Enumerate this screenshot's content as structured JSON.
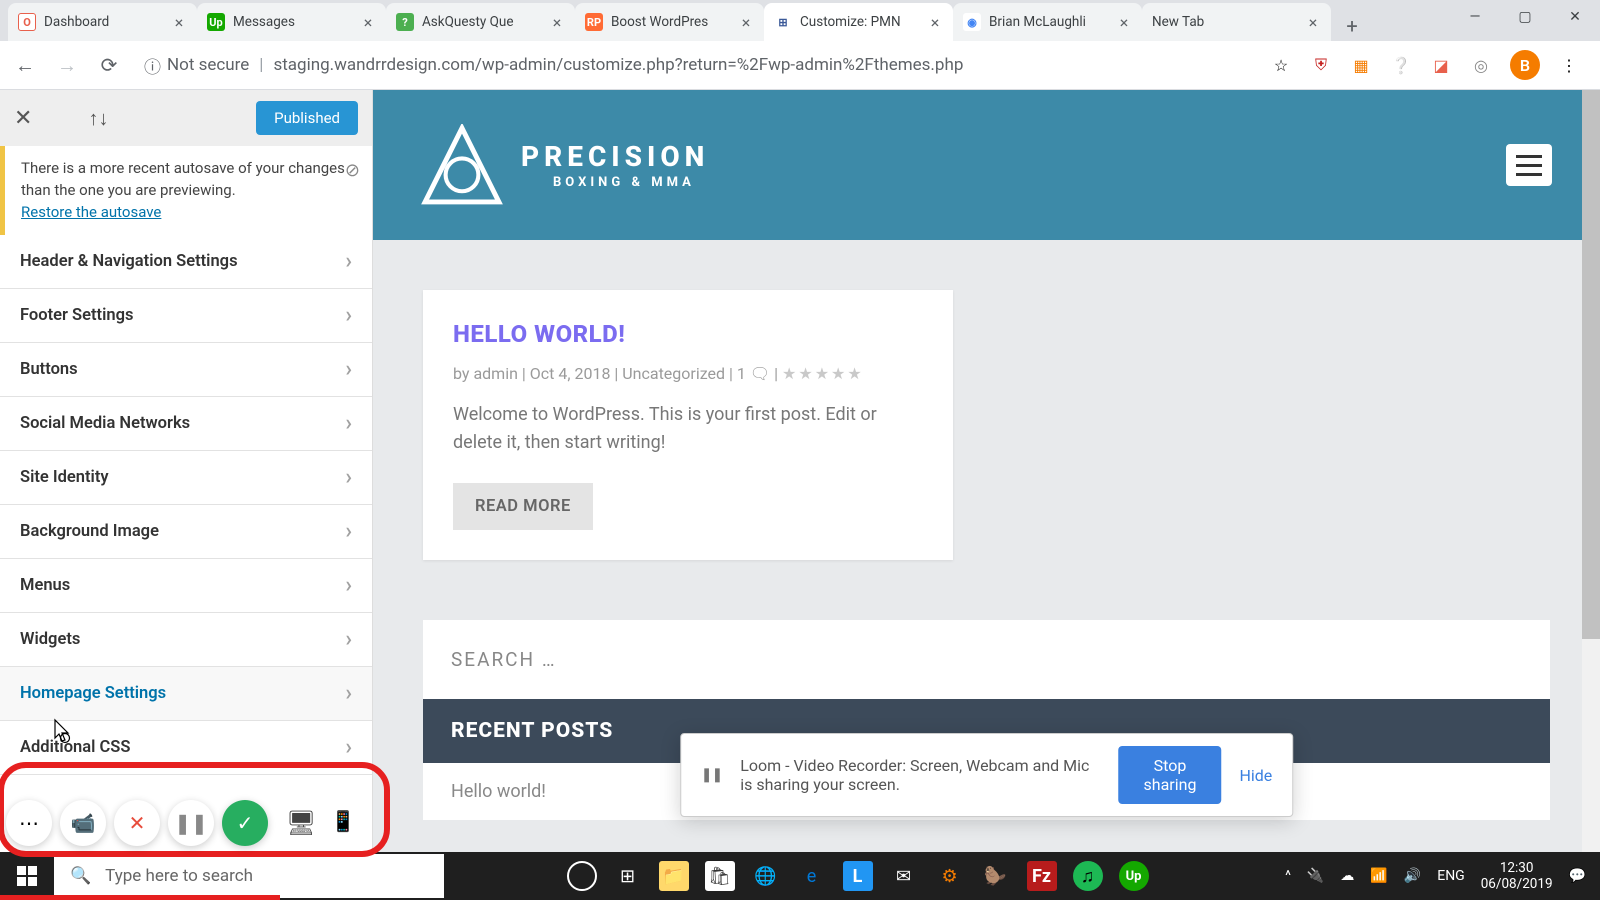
{
  "browser": {
    "tabs": [
      {
        "icon_bg": "#fff",
        "icon_txt": "O",
        "icon_color": "#e8604c",
        "title": "Dashboard"
      },
      {
        "icon_bg": "#14a800",
        "icon_txt": "Up",
        "icon_color": "#fff",
        "title": "Messages"
      },
      {
        "icon_bg": "#4caf50",
        "icon_txt": "?",
        "icon_color": "#fff",
        "title": "AskQuesty Que"
      },
      {
        "icon_bg": "#ff6b35",
        "icon_txt": "RP",
        "icon_color": "#fff",
        "title": "Boost WordPres"
      },
      {
        "icon_bg": "#3b5998",
        "icon_txt": "⊞",
        "icon_color": "#fff",
        "title": "Customize: PMN",
        "active": true
      },
      {
        "icon_bg": "#fff",
        "icon_txt": "◉",
        "icon_color": "#4285f4",
        "title": "Brian McLaughli"
      },
      {
        "icon_bg": "",
        "icon_txt": "",
        "icon_color": "",
        "title": "New Tab"
      }
    ],
    "security_label": "Not secure",
    "url": "staging.wandrrdesign.com/wp-admin/customize.php?return=%2Fwp-admin%2Fthemes.php",
    "avatar_letter": "B"
  },
  "customizer": {
    "published_label": "Published",
    "autosave_msg": "There is a more recent autosave of your changes than the one you are previewing.",
    "autosave_link": "Restore the autosave",
    "panels": [
      "Header & Navigation Settings",
      "Footer Settings",
      "Buttons",
      "Social Media Networks",
      "Site Identity",
      "Background Image",
      "Menus",
      "Widgets",
      "Homepage Settings",
      "Additional CSS"
    ]
  },
  "site": {
    "logo_line1": "PRECISION",
    "logo_line2": "BOXING & MMA",
    "post": {
      "title": "HELLO WORLD!",
      "meta_author_prefix": "by ",
      "meta_author": "admin",
      "meta_date": "Oct 4, 2018",
      "meta_cat": "Uncategorized",
      "meta_comments": "1 🗨",
      "excerpt": "Welcome to WordPress. This is your first post. Edit or delete it, then start writing!",
      "read_more": "READ MORE"
    },
    "search_placeholder": "SEARCH …",
    "recent_posts_title": "RECENT POSTS",
    "recent_post_item": "Hello world!"
  },
  "share_bar": {
    "msg": "Loom - Video Recorder: Screen, Webcam and Mic is sharing your screen.",
    "stop": "Stop sharing",
    "hide": "Hide"
  },
  "taskbar": {
    "search_placeholder": "Type here to search",
    "lang": "ENG",
    "time": "12:30",
    "date": "06/08/2019"
  }
}
